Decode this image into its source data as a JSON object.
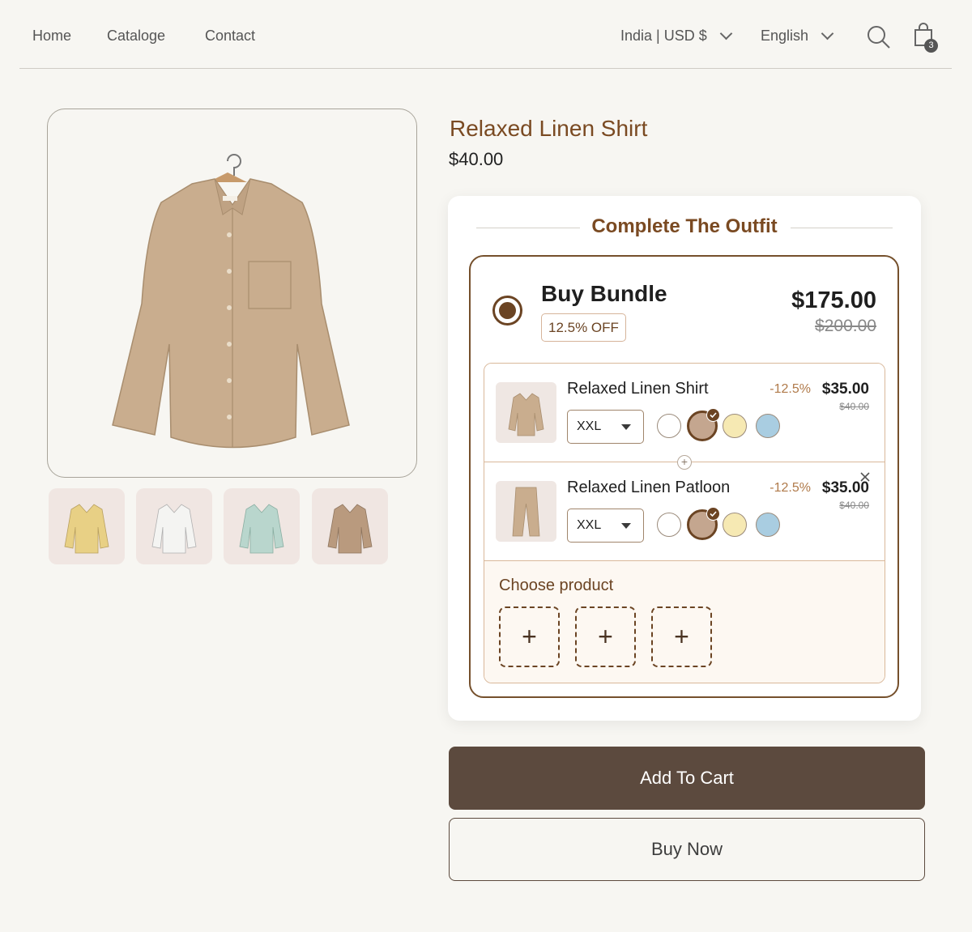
{
  "nav": {
    "links": [
      "Home",
      "Cataloge",
      "Contact"
    ],
    "region": "India | USD $",
    "language": "English",
    "cart_count": "3"
  },
  "product": {
    "title": "Relaxed Linen Shirt",
    "price": "$40.00",
    "main_color": "#c9ad8e",
    "thumbnail_colors": [
      "#e8d085",
      "#f4f4f2",
      "#b9d6cd",
      "#b99a7e"
    ]
  },
  "bundle": {
    "heading": "Complete The Outfit",
    "title": "Buy Bundle",
    "off_badge": "12.5% OFF",
    "price": "$175.00",
    "old_price": "$200.00",
    "items": [
      {
        "name": "Relaxed Linen Shirt",
        "discount": "-12.5%",
        "price": "$35.00",
        "old_price": "$40.00",
        "size": "XXL",
        "swatches": [
          "#ffffff",
          "#c4a68f",
          "#f6e9b3",
          "#a9cde1"
        ],
        "selected_swatch": 1
      },
      {
        "name": "Relaxed Linen Patloon",
        "discount": "-12.5%",
        "price": "$35.00",
        "old_price": "$40.00",
        "size": "XXL",
        "swatches": [
          "#ffffff",
          "#c4a68f",
          "#f6e9b3",
          "#a9cde1"
        ],
        "selected_swatch": 1
      }
    ],
    "choose_label": "Choose product",
    "add_slots": [
      "+",
      "+",
      "+"
    ]
  },
  "actions": {
    "add_to_cart": "Add To Cart",
    "buy_now": "Buy Now"
  }
}
